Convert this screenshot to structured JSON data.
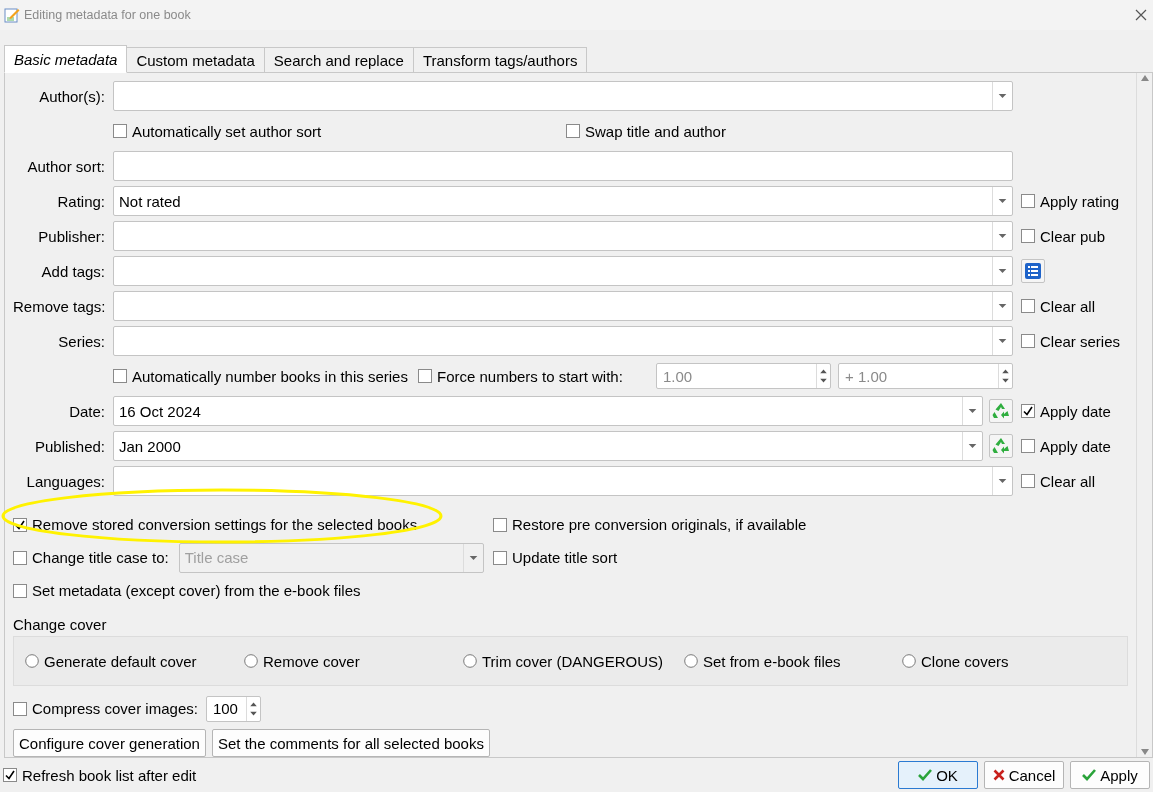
{
  "window": {
    "title": "Editing metadata for one book"
  },
  "tabs": [
    {
      "label": "Basic metadata",
      "selected": true
    },
    {
      "label": "Custom metadata",
      "selected": false
    },
    {
      "label": "Search and replace",
      "selected": false
    },
    {
      "label": "Transform tags/authors",
      "selected": false
    }
  ],
  "rows": [
    {
      "kind": "combo",
      "label": "Author(s):"
    },
    {
      "kind": "checks",
      "items": [
        {
          "label": "Automatically set author sort",
          "checked": false
        },
        {
          "label": "Swap title and author",
          "checked": false
        }
      ]
    },
    {
      "kind": "text",
      "label": "Author sort:"
    },
    {
      "kind": "combo",
      "label": "Rating:",
      "value": "Not rated",
      "side": {
        "kind": "checkbox",
        "label": "Apply rating",
        "checked": false
      }
    },
    {
      "kind": "combo",
      "label": "Publisher:",
      "side": {
        "kind": "checkbox",
        "label": "Clear pub",
        "checked": false
      }
    },
    {
      "kind": "combo",
      "label": "Add tags:",
      "side": {
        "kind": "list-button"
      }
    },
    {
      "kind": "combo",
      "label": "Remove tags:",
      "side": {
        "kind": "checkbox",
        "label": "Clear all",
        "checked": false
      }
    },
    {
      "kind": "combo",
      "label": "Series:",
      "side": {
        "kind": "checkbox",
        "label": "Clear series",
        "checked": false
      }
    },
    {
      "kind": "numbers",
      "auto": {
        "label": "Automatically number books in this series",
        "checked": false
      },
      "force": {
        "label": "Force numbers to start with:",
        "checked": false
      },
      "spins": [
        {
          "value": "1.00",
          "disabled": true
        },
        {
          "value": "+ 1.00",
          "disabled": true
        }
      ]
    },
    {
      "kind": "date",
      "label": "Date:",
      "value": "16 Oct 2024",
      "side": {
        "kind": "checkbox",
        "label": "Apply date",
        "checked": true
      }
    },
    {
      "kind": "date",
      "label": "Published:",
      "value": "Jan 2000",
      "side": {
        "kind": "checkbox",
        "label": "Apply date",
        "checked": false
      }
    },
    {
      "kind": "combo",
      "label": "Languages:",
      "side": {
        "kind": "checkbox",
        "label": "Clear all",
        "checked": false
      }
    }
  ],
  "options": {
    "remove_conversion": {
      "label": "Remove stored conversion settings for the selected books",
      "checked": true
    },
    "restore_originals": {
      "label": "Restore pre conversion originals, if available",
      "checked": false
    },
    "change_case": {
      "label": "Change title case to:",
      "checked": false
    },
    "case_select": {
      "value": "Title case",
      "disabled": true
    },
    "update_sort": {
      "label": "Update title sort",
      "checked": false
    },
    "set_metadata": {
      "label": "Set metadata (except cover) from the e-book files",
      "checked": false
    }
  },
  "cover": {
    "title": "Change cover",
    "options": [
      {
        "label": "Generate default cover",
        "selected": false
      },
      {
        "label": "Remove cover",
        "selected": false
      },
      {
        "label": "Trim cover (DANGEROUS)",
        "selected": false
      },
      {
        "label": "Set from e-book files",
        "selected": false
      },
      {
        "label": "Clone covers",
        "selected": false
      }
    ]
  },
  "compress": {
    "label": "Compress cover images:",
    "checked": false,
    "value": "100"
  },
  "buttons": [
    "Configure cover generation",
    "Set the comments for all selected books"
  ],
  "footer": {
    "refresh": {
      "label": "Refresh book list after edit",
      "checked": true
    },
    "buttons": [
      {
        "label": "OK",
        "kind": "ok",
        "default": true
      },
      {
        "label": "Cancel",
        "kind": "cancel",
        "default": false
      },
      {
        "label": "Apply",
        "kind": "ok",
        "default": false
      }
    ]
  }
}
